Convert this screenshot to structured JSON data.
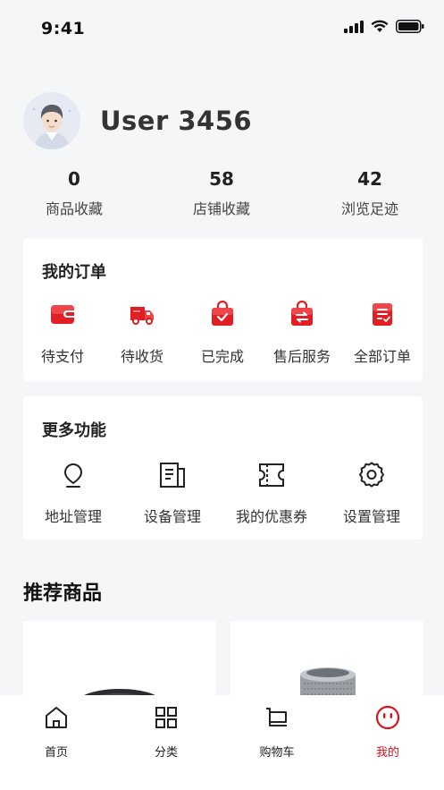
{
  "status_bar": {
    "time": "9:41"
  },
  "profile": {
    "username": "User 3456"
  },
  "stats": [
    {
      "value": "0",
      "label": "商品收藏"
    },
    {
      "value": "58",
      "label": "店铺收藏"
    },
    {
      "value": "42",
      "label": "浏览足迹"
    }
  ],
  "orders": {
    "title": "我的订单",
    "items": [
      {
        "label": "待支付",
        "icon": "wallet-icon"
      },
      {
        "label": "待收货",
        "icon": "delivery-truck-icon"
      },
      {
        "label": "已完成",
        "icon": "completed-bag-icon"
      },
      {
        "label": "售后服务",
        "icon": "exchange-bag-icon"
      },
      {
        "label": "全部订单",
        "icon": "order-list-icon"
      }
    ]
  },
  "functions": {
    "title": "更多功能",
    "items": [
      {
        "label": "地址管理",
        "icon": "location-pin-icon"
      },
      {
        "label": "设备管理",
        "icon": "device-icon"
      },
      {
        "label": "我的优惠券",
        "icon": "coupon-icon"
      },
      {
        "label": "设置管理",
        "icon": "gear-icon"
      }
    ]
  },
  "recommend": {
    "title": "推荐商品"
  },
  "tabbar": {
    "items": [
      {
        "label": "首页",
        "icon": "home-icon",
        "active": false
      },
      {
        "label": "分类",
        "icon": "grid-icon",
        "active": false
      },
      {
        "label": "购物车",
        "icon": "cart-icon",
        "active": false
      },
      {
        "label": "我的",
        "icon": "smiley-icon",
        "active": true
      }
    ]
  },
  "colors": {
    "accent": "#d8141b",
    "background": "#f5f6f8"
  }
}
